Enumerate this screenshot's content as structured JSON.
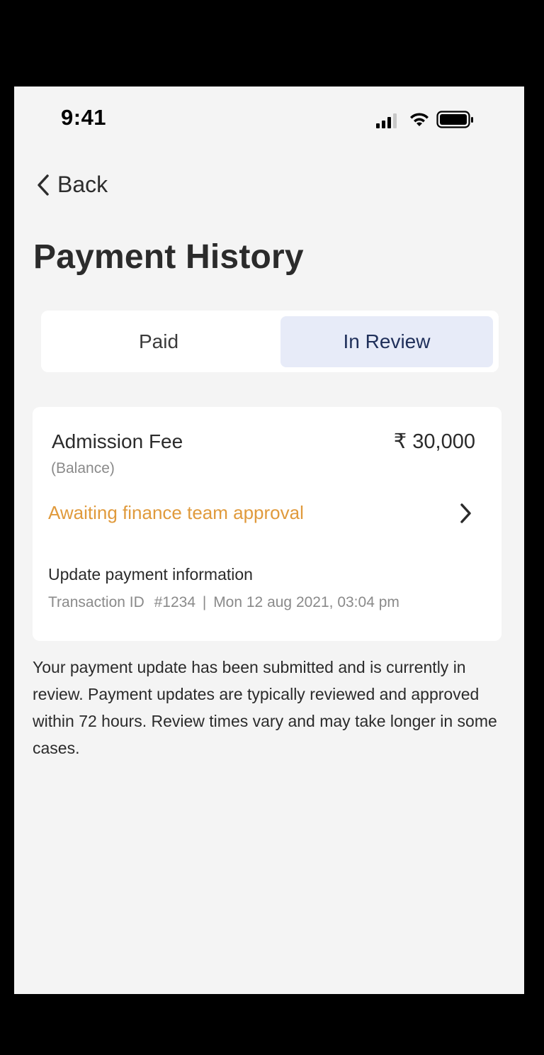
{
  "status_bar": {
    "time": "9:41",
    "icons": [
      "cellular-signal-icon",
      "wifi-icon",
      "battery-icon"
    ]
  },
  "nav": {
    "back_label": "Back"
  },
  "page": {
    "title": "Payment History"
  },
  "tabs": [
    {
      "label": "Paid",
      "selected": false
    },
    {
      "label": "In Review",
      "selected": true
    }
  ],
  "payment": {
    "title": "Admission Fee",
    "subtitle": "(Balance)",
    "amount": "₹ 30,000",
    "status": "Awaiting finance team approval",
    "update_title": "Update payment information",
    "transaction_label": "Transaction ID",
    "transaction_id": "#1234",
    "separator": "|",
    "transaction_datetime": "Mon 12 aug 2021, 03:04 pm"
  },
  "description": "Your payment update has been submitted and is currently in review. Payment updates are typically reviewed and approved within 72 hours. Review times vary and may take longer in some cases.",
  "colors": {
    "background": "#f4f4f4",
    "card": "#ffffff",
    "status_pending": "#e09a3c",
    "tab_selected_bg": "#e7ebf8",
    "tab_selected_text": "#1f2f5a"
  }
}
